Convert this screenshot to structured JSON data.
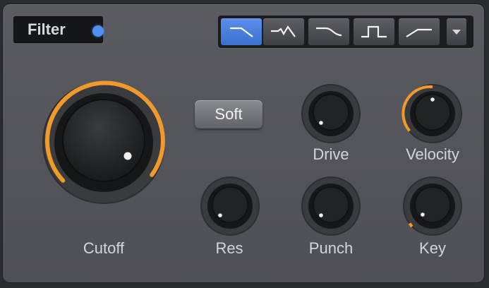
{
  "header": {
    "title": "Filter",
    "led_color": "#4f8ff0"
  },
  "filter_types": [
    {
      "name": "lowpass-icon",
      "active": true
    },
    {
      "name": "bandpass-icon",
      "active": false
    },
    {
      "name": "highshelf-icon",
      "active": false
    },
    {
      "name": "notch-icon",
      "active": false
    },
    {
      "name": "highpass-icon",
      "active": false
    }
  ],
  "soft_button": {
    "label": "Soft"
  },
  "accent_color": "#f09a2c",
  "knobs": {
    "cutoff": {
      "label": "Cutoff"
    },
    "drive": {
      "label": "Drive"
    },
    "velocity": {
      "label": "Velocity"
    },
    "res": {
      "label": "Res"
    },
    "punch": {
      "label": "Punch"
    },
    "key": {
      "label": "Key"
    }
  }
}
